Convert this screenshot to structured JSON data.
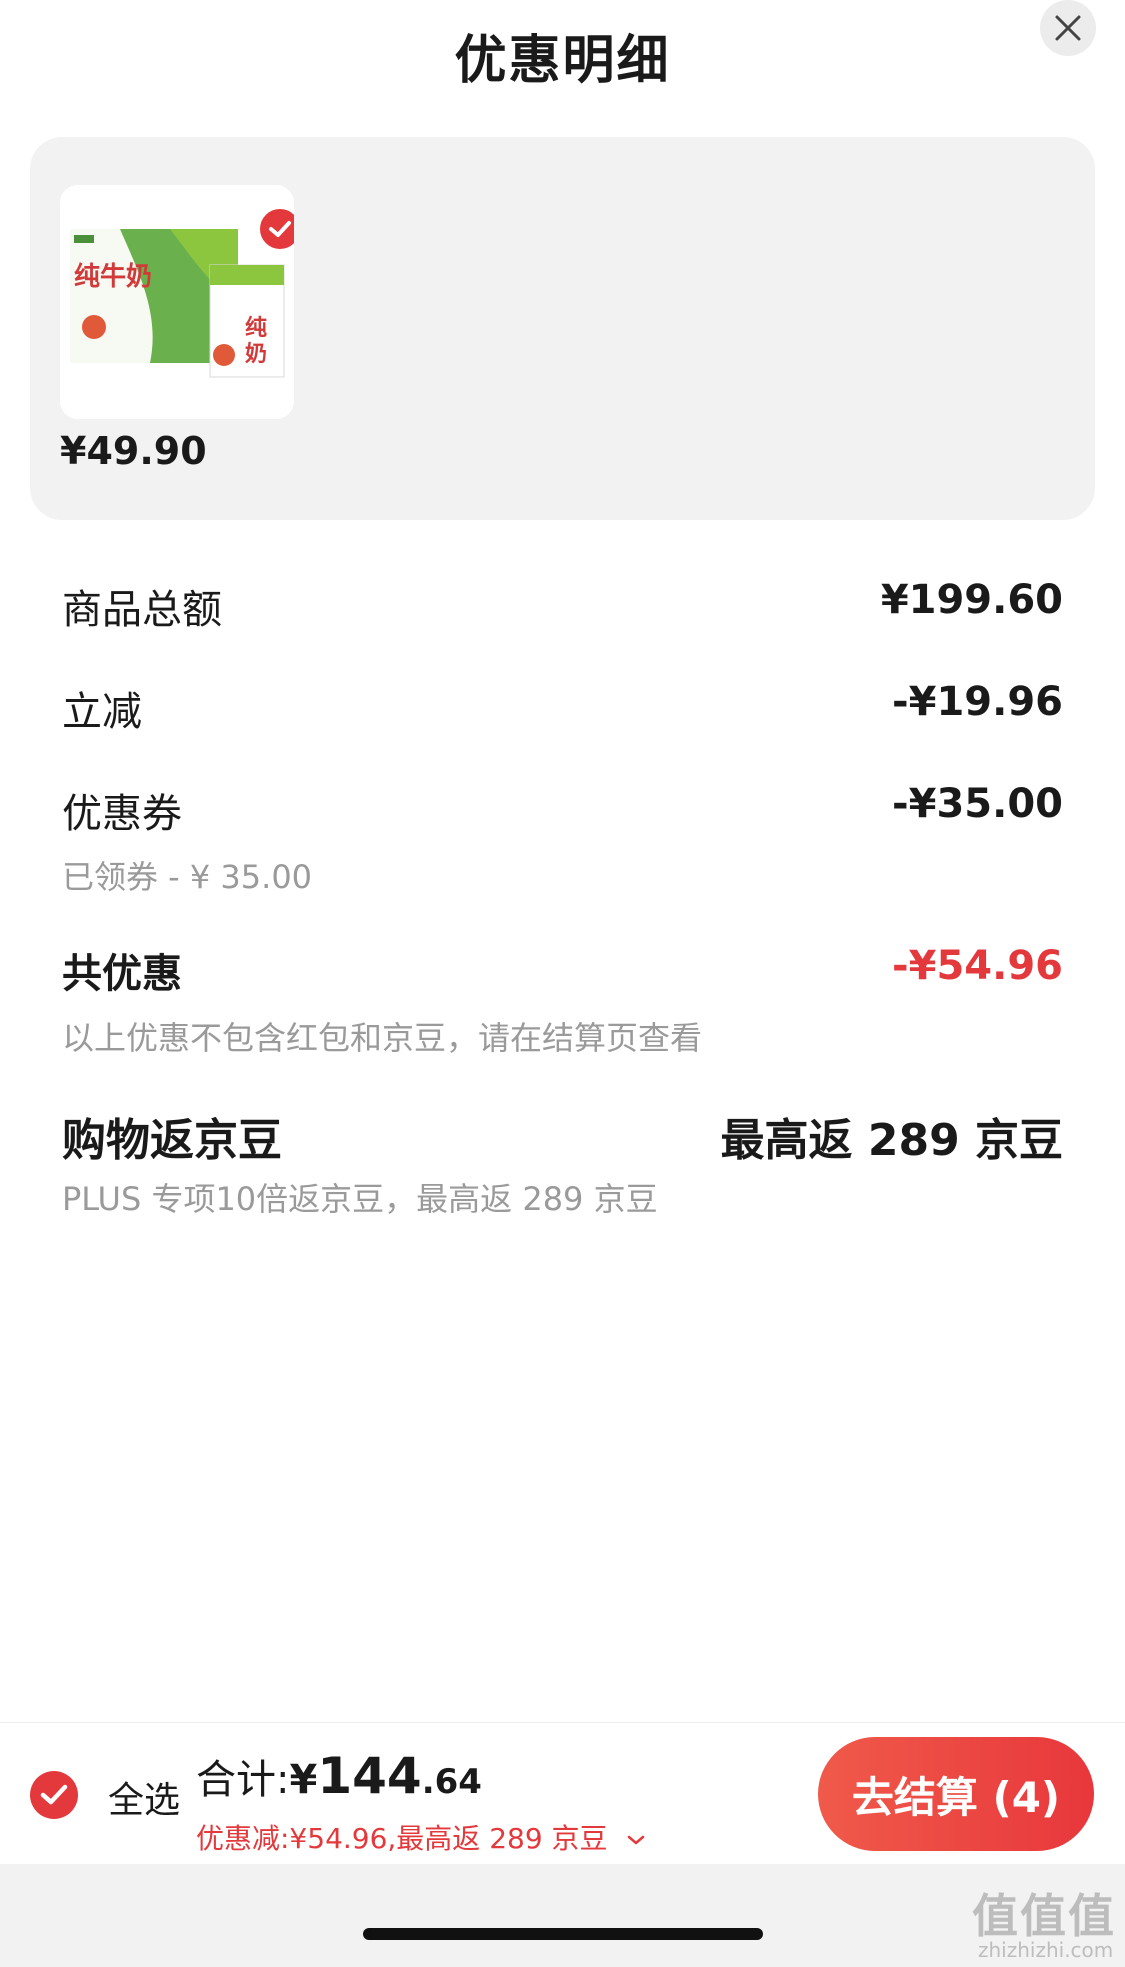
{
  "header": {
    "title": "优惠明细",
    "close_icon": "close-icon"
  },
  "product": {
    "price": "¥49.90",
    "image_alt": "纯牛奶",
    "selected": true
  },
  "summary": {
    "goods_total_label": "商品总额",
    "goods_total_value": "¥199.60",
    "instant_label": "立减",
    "instant_value": "-¥19.96",
    "coupon_label": "优惠券",
    "coupon_value": "-¥35.00",
    "coupon_note": "已领券 - ¥ 35.00",
    "total_discount_label": "共优惠",
    "total_discount_value": "-¥54.96",
    "total_discount_note": "以上优惠不包含红包和京豆，请在结算页查看",
    "beans_label": "购物返京豆",
    "beans_value": "最高返 289 京豆",
    "beans_note": "PLUS 专项10倍返京豆，最高返 289 京豆"
  },
  "footer": {
    "select_all": "全选",
    "total_label": "合计:",
    "total_currency": "¥",
    "total_integer": "144",
    "total_decimal": ".64",
    "savings": "优惠减:¥54.96,最高返 289 京豆",
    "checkout": "去结算 (4)"
  },
  "colors": {
    "accent": "#e4393c",
    "card_bg": "#f2f2f2",
    "muted": "#9a9a9a"
  },
  "watermark": {
    "text": "值值值",
    "url": "zhizhizhi.com"
  }
}
